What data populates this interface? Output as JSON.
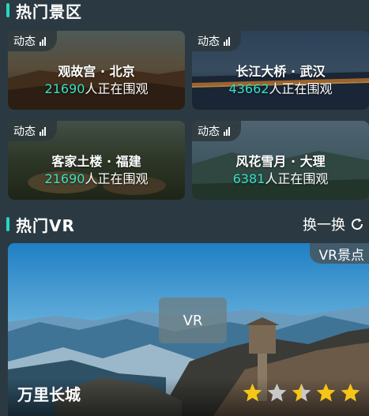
{
  "hot_spots": {
    "title": "热门景区",
    "cards": [
      {
        "badge": "动态",
        "title": "观故宫 · 北京",
        "count": "21690",
        "suffix": "人正在围观"
      },
      {
        "badge": "动态",
        "title": "长江大桥 · 武汉",
        "count": "43662",
        "suffix": "人正在围观"
      },
      {
        "badge": "动态",
        "title": "客家土楼 · 福建",
        "count": "21690",
        "suffix": "人正在围观"
      },
      {
        "badge": "动态",
        "title": "风花雪月 · 大理",
        "count": "6381",
        "suffix": "人正在围观"
      }
    ]
  },
  "hot_vr": {
    "title": "热门VR",
    "refresh_label": "换一换",
    "badge": "VR景点",
    "play_label": "VR",
    "name": "万里长城",
    "rating": 3.5,
    "star_states": [
      "full",
      "empty",
      "half",
      "full",
      "full"
    ]
  },
  "colors": {
    "accent": "#2ad6c0",
    "count": "#38e0c4",
    "star": "#f5c518",
    "star_empty": "#c9c9c9"
  }
}
